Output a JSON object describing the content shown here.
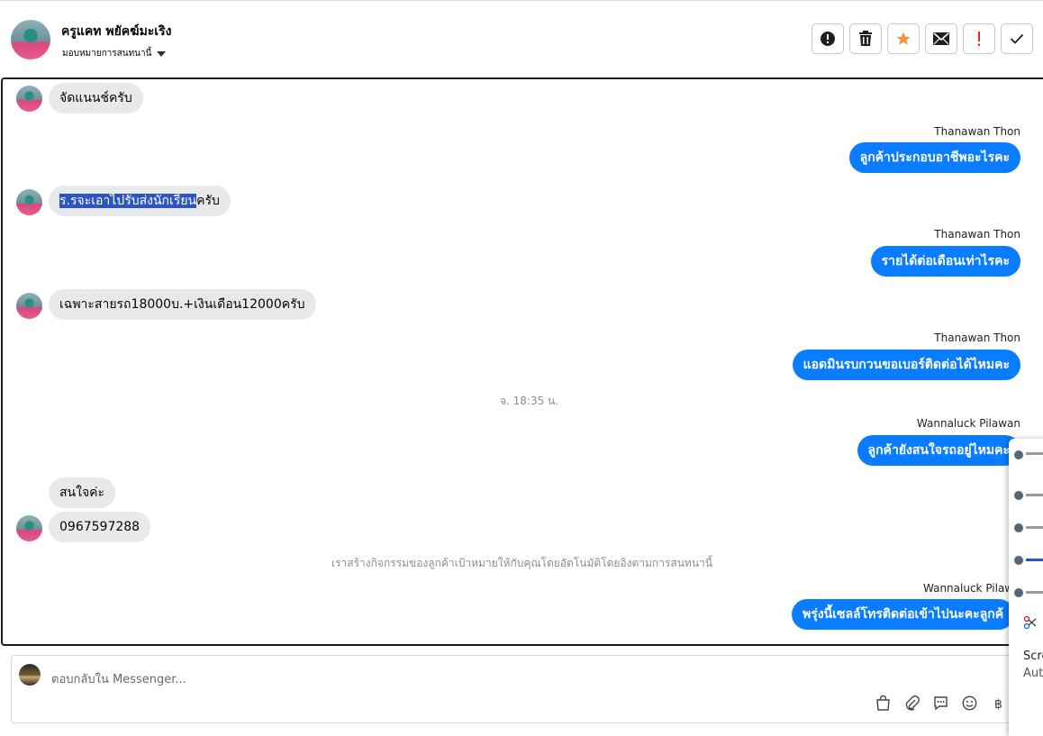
{
  "header": {
    "contact_name": "ครูแคท พยัคฆ์มะเริง",
    "assign_label": "มอบหมายการสนทนานี้",
    "actions": [
      "report-icon",
      "trash-icon",
      "star-icon",
      "mail-icon",
      "exclamation-icon",
      "check-icon"
    ]
  },
  "messages": {
    "m1": "จัดแนนช์ครับ",
    "m2_sender": "Thanawan Thon",
    "m2": "ลูกค้าประกอบอาชีพอะไรคะ",
    "m3_highlight": "ร.รจะเอาไปรับส่งนักเรียน",
    "m3_rest": "ครับ",
    "m4_sender": "Thanawan Thon",
    "m4": "รายได้ต่อเดือนเท่าไรคะ",
    "m5": "เฉพาะสายรถ18000บ.+เงินเดือน12000ครับ",
    "m6_sender": "Thanawan Thon",
    "m6": "แอดมินรบกวนขอเบอร์ติดต่อได้ไหมคะ",
    "timestamp": "จ. 18:35 น.",
    "m7_sender": "Wannaluck Pilawan",
    "m7": "ลูกค้ายังสนใจรถอยู่ไหมคะ",
    "m8": "สนใจค่ะ",
    "m9": "0967597288",
    "system_note": "เราสร้างกิจกรรมของลูกค้าเป้าหมายให้กับคุณโดยอัตโนมัติโดยอิงตามการสนทนานี้",
    "m10_sender": "Wannaluck Pilawa",
    "m10": "พรุ่งนี้เซลล์โทรติดต่อเข้าไปนะคะลูกค้"
  },
  "composer": {
    "placeholder": "ตอบกลับใน Messenger..."
  },
  "side_panel": {
    "line1": "Scre",
    "line2": "Aut"
  },
  "colors": {
    "outgoing": "#0a7cff",
    "incoming": "#e8e9eb",
    "highlight": "#2c55c4"
  }
}
